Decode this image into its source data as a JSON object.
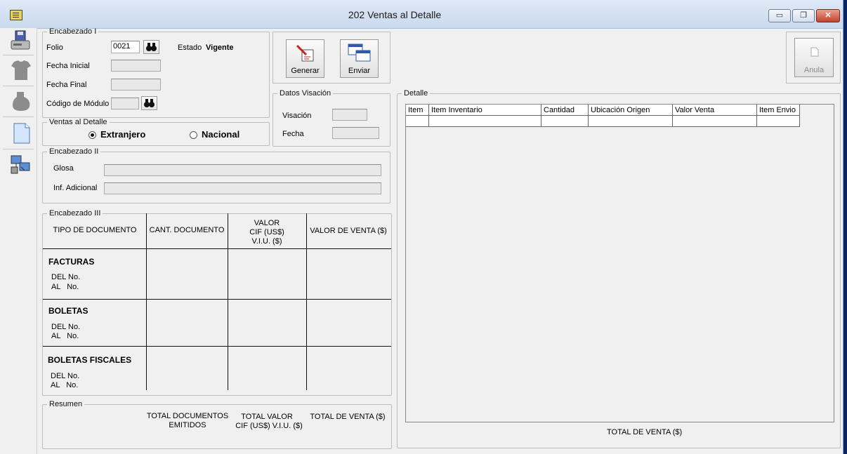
{
  "window": {
    "title": "202 Ventas al Detalle",
    "minimize": "▭",
    "restore": "❐",
    "close": "✕"
  },
  "toolbar": {
    "items": [
      "save-icon",
      "shirt-icon",
      "bag-icon",
      "new-document-icon",
      "network-icon"
    ]
  },
  "encabezado1": {
    "legend": "Encabezado I",
    "folio_label": "Folio",
    "folio_value": "0021",
    "estado_label": "Estado",
    "estado_value": "Vigente",
    "fecha_inicial_label": "Fecha Inicial",
    "fecha_final_label": "Fecha Final",
    "codigo_modulo_label": "Código de Módulo"
  },
  "actions": {
    "generar": "Generar",
    "enviar": "Enviar",
    "anula": "Anula"
  },
  "visacion": {
    "legend": "Datos Visación",
    "visacion_label": "Visación",
    "fecha_label": "Fecha"
  },
  "ventas_detalle": {
    "legend": "Ventas al Detalle",
    "option1": "Extranjero",
    "option2": "Nacional",
    "selected": "Extranjero"
  },
  "encabezado2": {
    "legend": "Encabezado II",
    "glosa_label": "Glosa",
    "inf_label": "Inf. Adicional"
  },
  "encabezado3": {
    "legend": "Encabezado III",
    "col_tipo": "TIPO DE DOCUMENTO",
    "col_cant": "CANT. DOCUMENTO",
    "col_valor_1": "VALOR",
    "col_valor_2": "CIF (US$)",
    "col_valor_3": "V.I.U. ($)",
    "col_venta": "VALOR DE VENTA ($)",
    "rows": [
      {
        "title": "FACTURAS",
        "del": "DEL No.",
        "al": "AL   No."
      },
      {
        "title": "BOLETAS",
        "del": "DEL No.",
        "al": "AL   No."
      },
      {
        "title": "BOLETAS FISCALES",
        "del": "DEL No.",
        "al": "AL   No."
      }
    ]
  },
  "resumen": {
    "legend": "Resumen",
    "total_docs_1": "TOTAL DOCUMENTOS",
    "total_docs_2": "EMITIDOS",
    "total_valor_1": "TOTAL VALOR",
    "total_valor_2": "CIF (US$) V.I.U. ($)",
    "total_venta": "TOTAL DE VENTA ($)"
  },
  "detalle": {
    "legend": "Detalle",
    "columns": [
      "Item",
      "Item Inventario",
      "Cantidad",
      "Ubicación Origen",
      "Valor Venta",
      "Item Envio"
    ],
    "total_label": "TOTAL DE VENTA ($)"
  }
}
